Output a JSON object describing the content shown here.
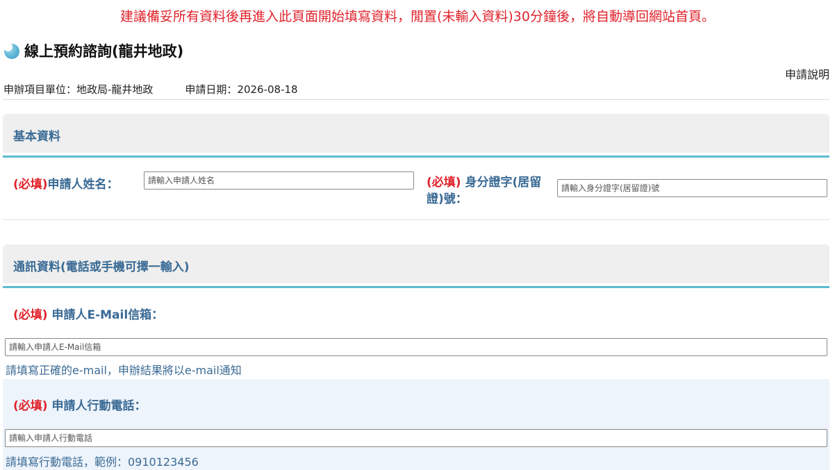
{
  "notice": "建議備妥所有資料後再進入此頁面開始填寫資料，閒置(未輸入資料)30分鐘後，將自動導回網站首頁。",
  "page_title": "線上預約諮詢(龍井地政)",
  "help_link": "申請說明",
  "meta": {
    "unit": "申辦項目單位：地政局-龍井地政",
    "date": "申請日期：2026-08-18"
  },
  "sections": {
    "basic": {
      "title": "基本資料",
      "name_field": {
        "required": "(必填)",
        "label": "申請人姓名：",
        "placeholder": "請輸入申請人姓名"
      },
      "id_field": {
        "required": "(必填)",
        "label_line1": " 身分證字(居留",
        "label_line2": "證)號：",
        "placeholder": "請輸入身分證字(居留證)號"
      }
    },
    "contact": {
      "title": "通訊資料(電話或手機可擇一輸入)",
      "email_field": {
        "required": "(必填)",
        "label_prefix": " 申請人",
        "label_bold": "E-Mail",
        "label_suffix": "信箱：",
        "placeholder": "請輸入申請人E-Mail信箱",
        "hint": "請填寫正確的e-mail，申辦結果將以e-mail通知"
      },
      "mobile_field": {
        "required": "(必填)",
        "label": " 申請人行動電話：",
        "placeholder": "請輸入申請人行動電話",
        "hint": "請填寫行動電話，範例：0910123456"
      }
    }
  }
}
